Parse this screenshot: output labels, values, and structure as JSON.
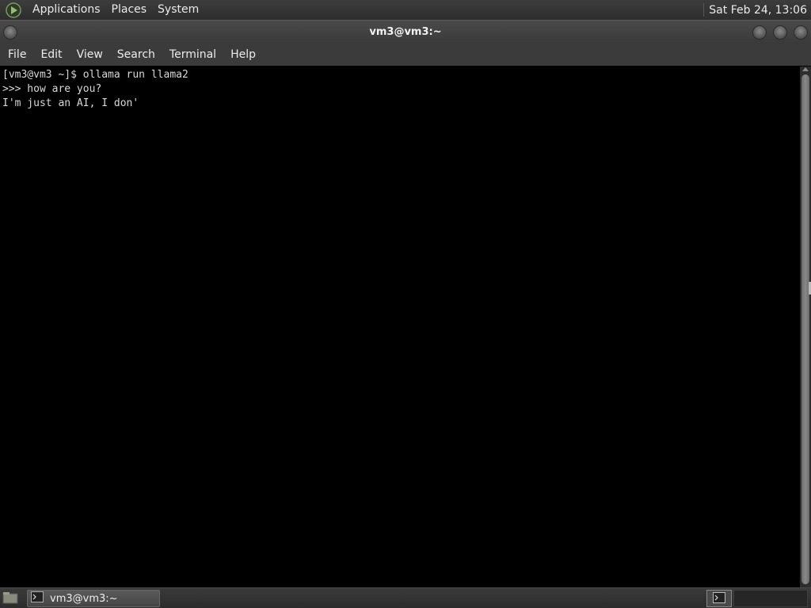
{
  "top_panel": {
    "menus": [
      "Applications",
      "Places",
      "System"
    ],
    "clock": "Sat Feb 24, 13:06"
  },
  "window": {
    "title": "vm3@vm3:~"
  },
  "menubar": {
    "items": [
      "File",
      "Edit",
      "View",
      "Search",
      "Terminal",
      "Help"
    ]
  },
  "terminal": {
    "lines": [
      "[vm3@vm3 ~]$ ollama run llama2",
      ">>> how are you?",
      "I'm just an AI, I don'"
    ]
  },
  "taskbar": {
    "window_button_label": "vm3@vm3:~"
  },
  "icons": {
    "menu_logo": "gnome-foot-icon",
    "terminal": "terminal-icon",
    "show_desktop": "show-desktop-icon"
  }
}
